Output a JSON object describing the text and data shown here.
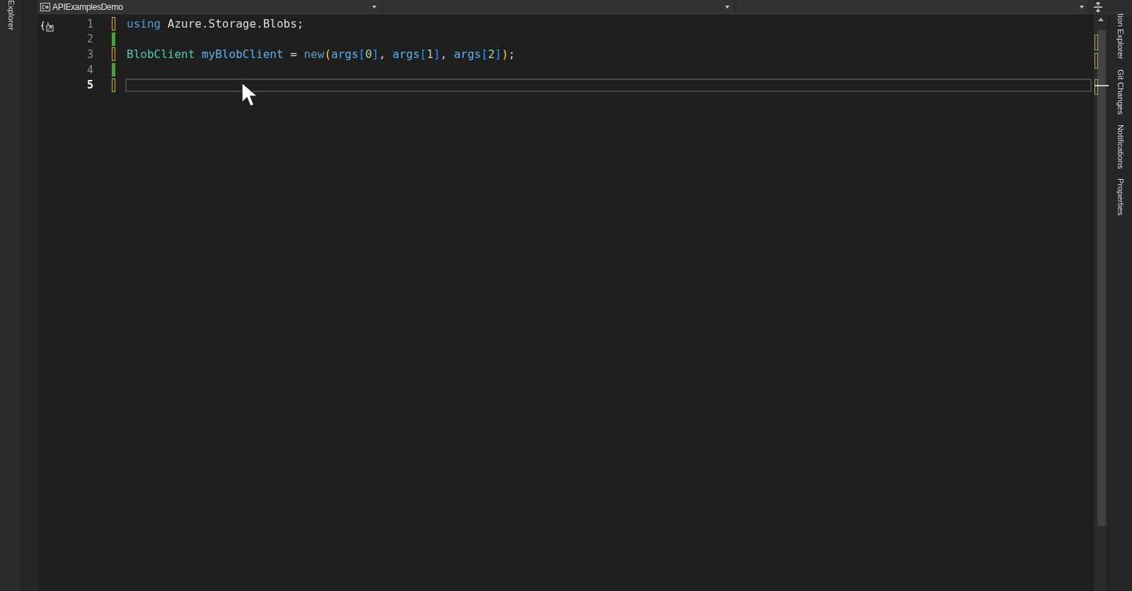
{
  "left_panel_tabs": [
    "Explorer"
  ],
  "navigation_bar": {
    "project": "APIExamplesDemo"
  },
  "editor": {
    "lines": [
      {
        "number": "1",
        "modified": true,
        "current": false,
        "tokens": [
          {
            "kind": "keyword",
            "text": "using"
          },
          {
            "kind": "plain",
            "text": " Azure.Storage.Blobs;"
          }
        ]
      },
      {
        "number": "2",
        "modified": false,
        "current": false
      },
      {
        "number": "3",
        "modified": true,
        "current": false,
        "tokens": [
          {
            "kind": "type",
            "text": "BlobClient "
          },
          {
            "kind": "ident",
            "text": "myBlobClient"
          },
          {
            "kind": "plain",
            "text": " = "
          },
          {
            "kind": "keyword",
            "text": "new"
          },
          {
            "kind": "paren",
            "text": "("
          },
          {
            "kind": "ident",
            "text": "args"
          },
          {
            "kind": "bracket",
            "text": "["
          },
          {
            "kind": "number",
            "text": "0"
          },
          {
            "kind": "bracket",
            "text": "]"
          },
          {
            "kind": "plain",
            "text": ", "
          },
          {
            "kind": "ident",
            "text": "args"
          },
          {
            "kind": "bracket",
            "text": "["
          },
          {
            "kind": "number",
            "text": "1"
          },
          {
            "kind": "bracket",
            "text": "]"
          },
          {
            "kind": "plain",
            "text": ", "
          },
          {
            "kind": "ident",
            "text": "args"
          },
          {
            "kind": "bracket",
            "text": "["
          },
          {
            "kind": "number",
            "text": "2"
          },
          {
            "kind": "bracket",
            "text": "]"
          },
          {
            "kind": "paren",
            "text": ")"
          },
          {
            "kind": "plain",
            "text": ";"
          }
        ]
      },
      {
        "number": "4",
        "modified": false,
        "current": false
      },
      {
        "number": "5",
        "modified": true,
        "current": true
      }
    ]
  },
  "right_panel_tabs": [
    "tion Explorer",
    "Git Changes",
    "Notifications",
    "Properties"
  ]
}
